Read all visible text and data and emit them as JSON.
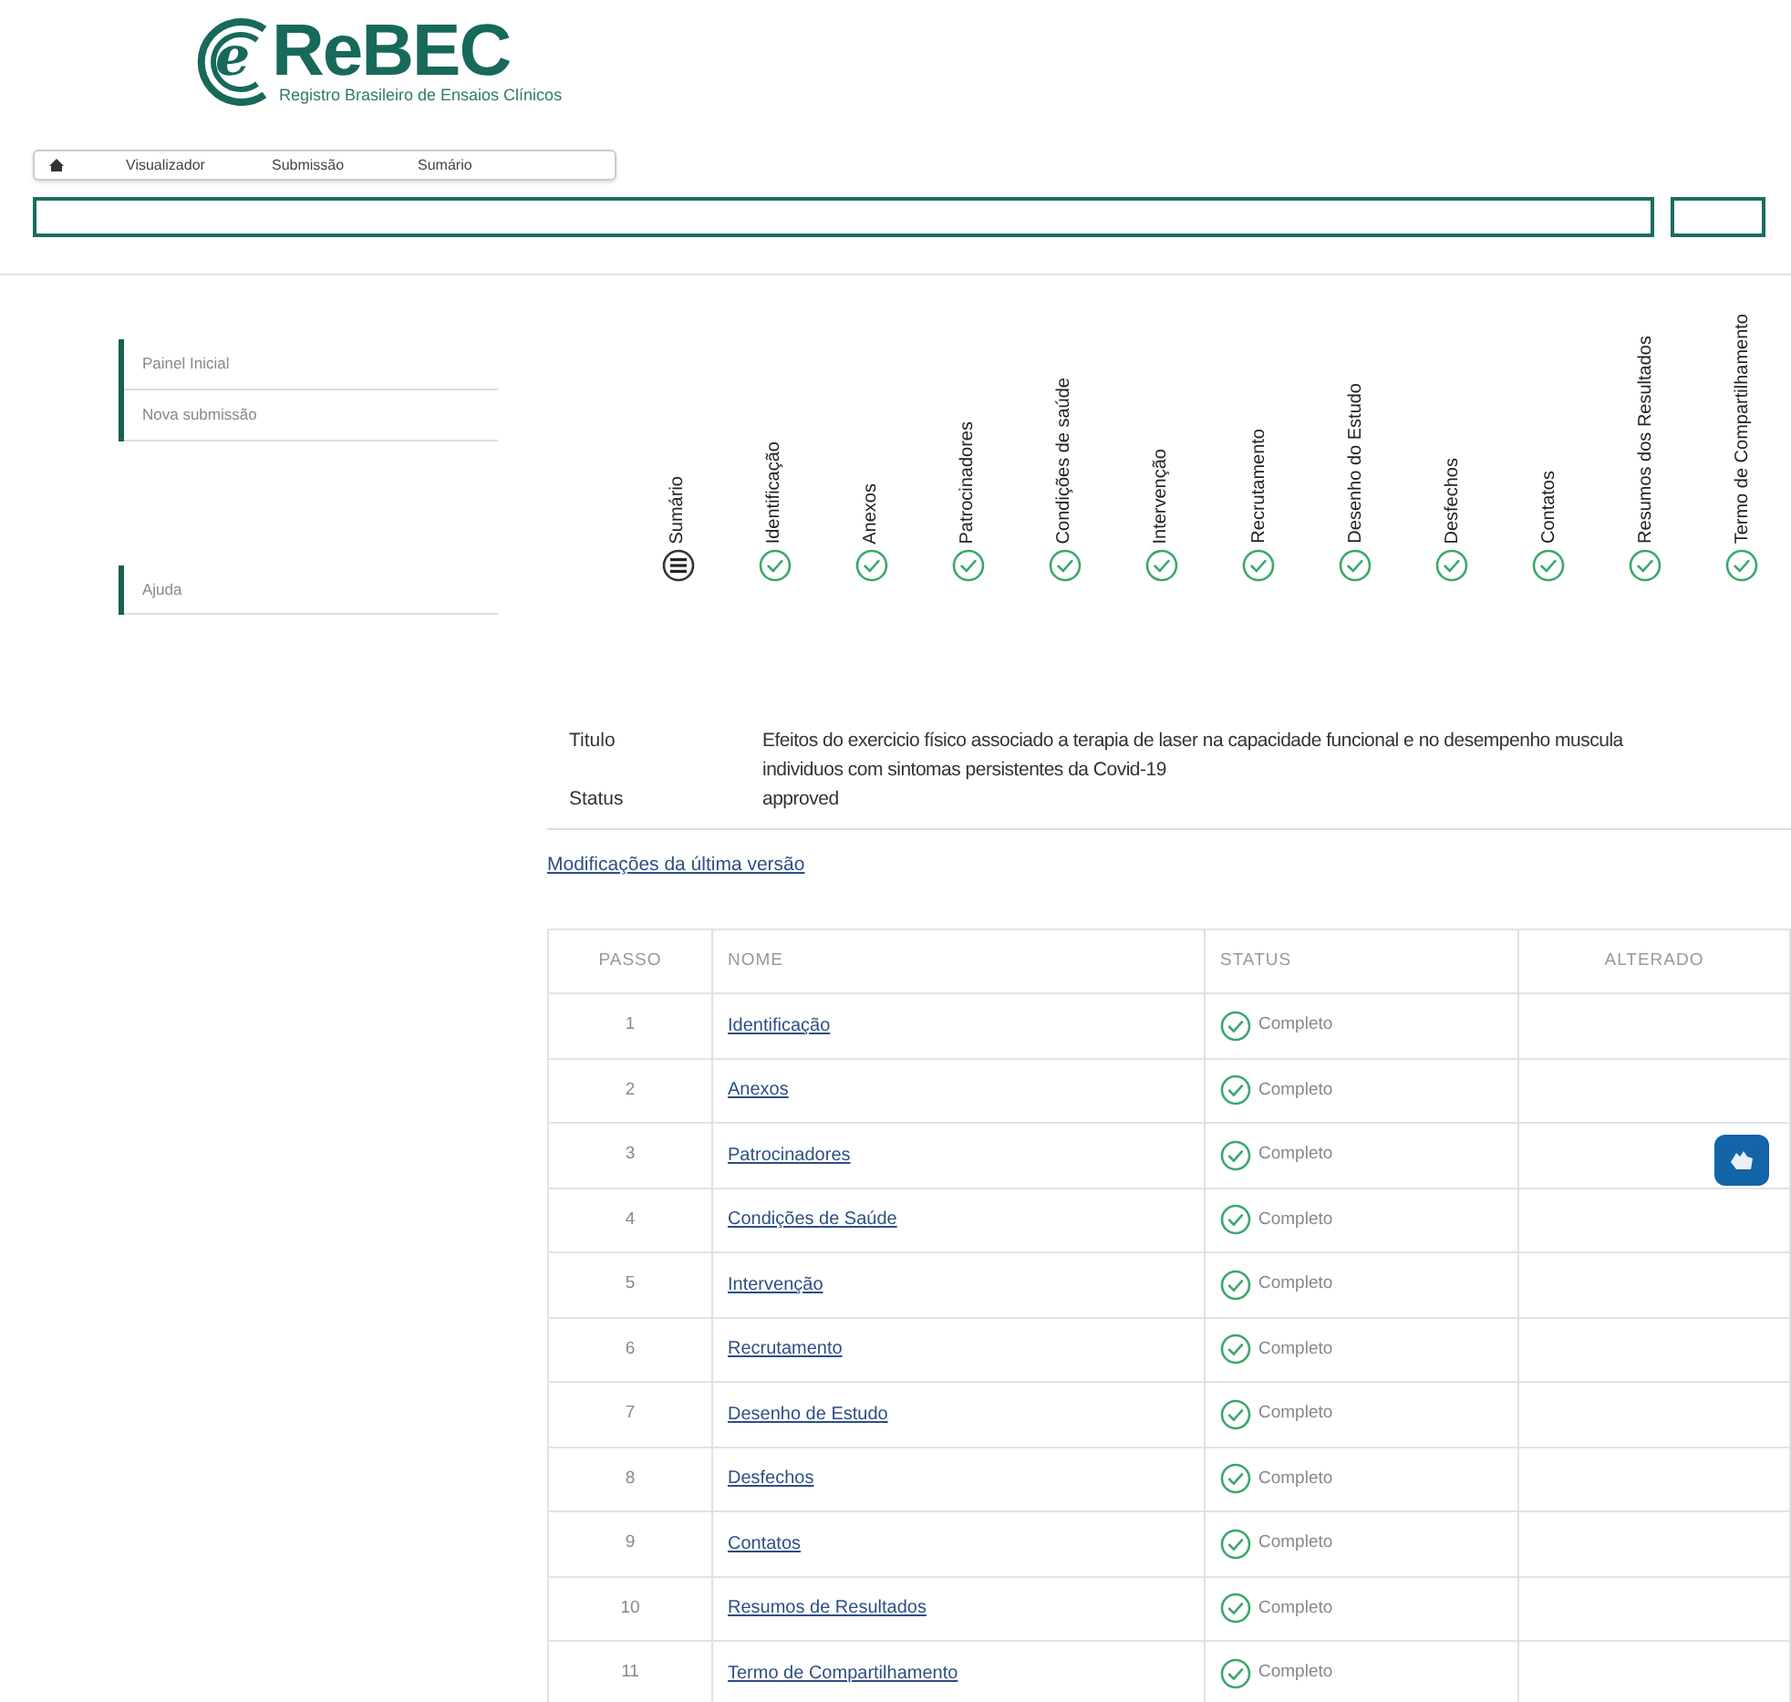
{
  "logo": {
    "mark": "e",
    "name": "ReBEC",
    "subtitle": "Registro Brasileiro de Ensaios Clínicos"
  },
  "nav": [
    "Visualizador",
    "Submissão",
    "Sumário"
  ],
  "sidebar": {
    "groups": [
      [
        "Painel Inicial",
        "Nova submissão"
      ],
      [
        "Ajuda"
      ]
    ]
  },
  "steps": [
    {
      "label": "Sumário",
      "kind": "summary"
    },
    {
      "label": "Identificação",
      "kind": "check"
    },
    {
      "label": "Anexos",
      "kind": "check"
    },
    {
      "label": "Patrocinadores",
      "kind": "check"
    },
    {
      "label": "Condições de saúde",
      "kind": "check"
    },
    {
      "label": "Intervenção",
      "kind": "check"
    },
    {
      "label": "Recrutamento",
      "kind": "check"
    },
    {
      "label": "Desenho do Estudo",
      "kind": "check"
    },
    {
      "label": "Desfechos",
      "kind": "check"
    },
    {
      "label": "Contatos",
      "kind": "check"
    },
    {
      "label": "Resumos dos Resultados",
      "kind": "check"
    },
    {
      "label": "Termo de Compartilhamento",
      "kind": "check"
    }
  ],
  "info": [
    {
      "label": "Titulo",
      "lines": [
        "Efeitos do exercicio físico associado a terapia de laser na capacidade funcional e no desempenho muscula",
        "individuos com sintomas persistentes da Covid-19"
      ]
    },
    {
      "label": "Status",
      "lines": [
        "approved"
      ]
    }
  ],
  "changes_link": "Modificações da última versão",
  "table": {
    "columns": [
      "PASSO",
      "NOME",
      "STATUS",
      "ALTERADO"
    ],
    "rows": [
      {
        "step": "1",
        "name": "Identificação",
        "status": "Completo"
      },
      {
        "step": "2",
        "name": "Anexos",
        "status": "Completo"
      },
      {
        "step": "3",
        "name": "Patrocinadores",
        "status": "Completo"
      },
      {
        "step": "4",
        "name": "Condições de Saúde",
        "status": "Completo"
      },
      {
        "step": "5",
        "name": "Intervenção",
        "status": "Completo"
      },
      {
        "step": "6",
        "name": "Recrutamento",
        "status": "Completo"
      },
      {
        "step": "7",
        "name": "Desenho de Estudo",
        "status": "Completo"
      },
      {
        "step": "8",
        "name": "Desfechos",
        "status": "Completo"
      },
      {
        "step": "9",
        "name": "Contatos",
        "status": "Completo"
      },
      {
        "step": "10",
        "name": "Resumos de Resultados",
        "status": "Completo"
      },
      {
        "step": "11",
        "name": "Termo de Compartilhamento",
        "status": "Completo"
      }
    ]
  }
}
